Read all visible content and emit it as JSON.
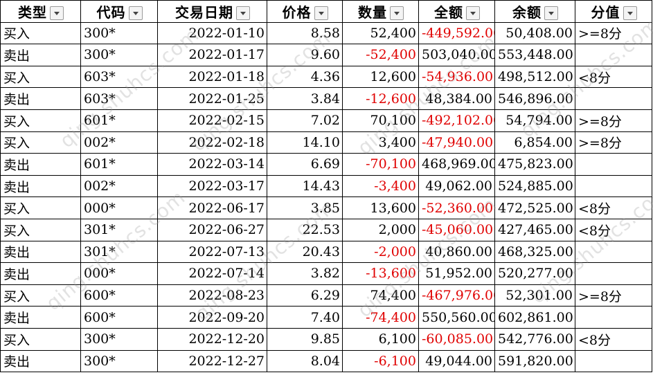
{
  "headers": [
    "类型",
    "代码",
    "交易日期",
    "价格",
    "数量",
    "全额",
    "余额",
    "分值"
  ],
  "rows": [
    [
      "买入",
      "300*",
      "2022-01-10",
      "8.58",
      "52,400",
      "-449,592.00",
      "50,408.00",
      ">=8分"
    ],
    [
      "卖出",
      "300*",
      "2022-01-17",
      "9.60",
      "-52,400",
      "503,040.00",
      "553,448.00",
      ""
    ],
    [
      "买入",
      "603*",
      "2022-01-18",
      "4.36",
      "12,600",
      "-54,936.00",
      "498,512.00",
      "<8分"
    ],
    [
      "卖出",
      "603*",
      "2022-01-25",
      "3.84",
      "-12,600",
      "48,384.00",
      "546,896.00",
      ""
    ],
    [
      "买入",
      "601*",
      "2022-02-15",
      "7.02",
      "70,100",
      "-492,102.00",
      "54,794.00",
      ">=8分"
    ],
    [
      "买入",
      "002*",
      "2022-02-18",
      "14.10",
      "3,400",
      "-47,940.00",
      "6,854.00",
      ">=8分"
    ],
    [
      "卖出",
      "601*",
      "2022-03-14",
      "6.69",
      "-70,100",
      "468,969.00",
      "475,823.00",
      ""
    ],
    [
      "卖出",
      "002*",
      "2022-03-17",
      "14.43",
      "-3,400",
      "49,062.00",
      "524,885.00",
      ""
    ],
    [
      "买入",
      "000*",
      "2022-06-17",
      "3.85",
      "13,600",
      "-52,360.00",
      "472,525.00",
      "<8分"
    ],
    [
      "买入",
      "301*",
      "2022-06-27",
      "22.53",
      "2,000",
      "-45,060.00",
      "427,465.00",
      "<8分"
    ],
    [
      "卖出",
      "301*",
      "2022-07-13",
      "20.43",
      "-2,000",
      "40,860.00",
      "468,325.00",
      ""
    ],
    [
      "卖出",
      "000*",
      "2022-07-14",
      "3.82",
      "-13,600",
      "51,952.00",
      "520,277.00",
      ""
    ],
    [
      "买入",
      "600*",
      "2022-08-23",
      "6.29",
      "74,400",
      "-467,976.00",
      "52,301.00",
      ">=8分"
    ],
    [
      "卖出",
      "600*",
      "2022-09-20",
      "7.40",
      "-74,400",
      "550,560.00",
      "602,861.00",
      ""
    ],
    [
      "买入",
      "300*",
      "2022-12-20",
      "9.85",
      "6,100",
      "-60,085.00",
      "542,776.00",
      "<8分"
    ],
    [
      "卖出",
      "300*",
      "2022-12-27",
      "8.04",
      "-6,100",
      "49,044.00",
      "591,820.00",
      ""
    ]
  ],
  "watermark": "qing.shuhcs.com",
  "colors": {
    "negative": "#e00000",
    "grid": "#000000",
    "header_bg": "#ffffff"
  }
}
